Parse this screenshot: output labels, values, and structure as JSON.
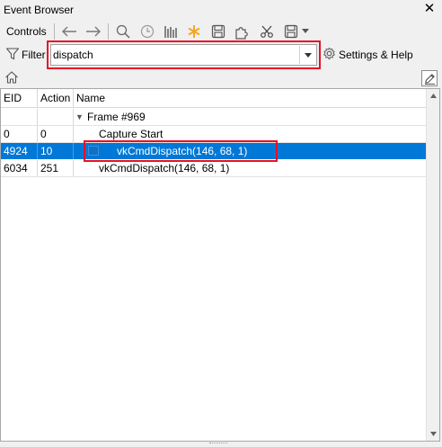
{
  "window": {
    "title": "Event Browser",
    "close_icon": "close-icon"
  },
  "toolbar": {
    "label": "Controls",
    "icons": [
      "arrow-left-icon",
      "arrow-right-icon",
      "search-icon",
      "clock-icon",
      "time-bars-icon",
      "asterisk-icon",
      "save-icon",
      "puzzle-icon",
      "scissors-icon",
      "save-dropdown-icon",
      "chevron-down-icon"
    ],
    "accent_color": "#f5a623"
  },
  "filter": {
    "label": "Filter",
    "value": "dispatch",
    "highlight_color": "#e81123",
    "settings_label": "Settings & Help"
  },
  "tree": {
    "columns": [
      "EID",
      "Action",
      "Name"
    ],
    "rows": [
      {
        "eid": "",
        "action": "",
        "name": "Frame #969",
        "expanded": true
      },
      {
        "eid": "0",
        "action": "0",
        "name": "Capture Start"
      },
      {
        "eid": "4924",
        "action": "10",
        "name": "vkCmdDispatch(146, 68, 1)",
        "selected": true,
        "bookmarked": true
      },
      {
        "eid": "6034",
        "action": "251",
        "name": "vkCmdDispatch(146, 68, 1)"
      }
    ],
    "selected_color": "#0078d7"
  }
}
